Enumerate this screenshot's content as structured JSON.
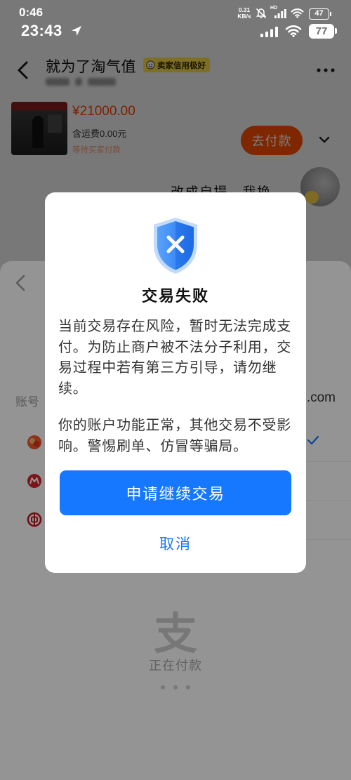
{
  "status_bar_1": {
    "time": "0:46",
    "net_speed_value": "0.31",
    "net_speed_unit": "KB/s",
    "signal_label": "HD",
    "battery": "47"
  },
  "status_bar_2": {
    "time": "23:43",
    "battery": "77"
  },
  "chat_header": {
    "title": "就为了淘气值",
    "badge": "卖家信用极好"
  },
  "product_card": {
    "price": "¥21000.00",
    "shipping": "含运费0.00元",
    "status": "等待买家付款",
    "pay_button": "去付款"
  },
  "chat_message": {
    "text": "改成自提，我换"
  },
  "payment_sheet": {
    "account_label": "账号",
    "account_suffix": ".com",
    "brand_logo": "支",
    "status": "正在付款",
    "methods": [
      {
        "icon": "yuebao-icon",
        "selected": true
      },
      {
        "icon": "cmb-bank-icon",
        "selected": false
      },
      {
        "icon": "boc-bank-icon",
        "selected": false
      }
    ]
  },
  "dialog": {
    "icon": "shield-x-icon",
    "title": "交易失败",
    "message": "当前交易存在风险，暂时无法完成支付。为防止商户被不法分子利用，交易过程中若有第三方引导，请勿继续。",
    "notice": "你的账户功能正常，其他交易不受影响。警惕刷单、仿冒等骗局。",
    "primary_button": "申请继续交易",
    "cancel_button": "取消"
  },
  "colors": {
    "accent_blue": "#1677ff",
    "price_red": "#ff4400",
    "pay_button": "#ff5000",
    "badge_yellow": "#ffe24a"
  }
}
